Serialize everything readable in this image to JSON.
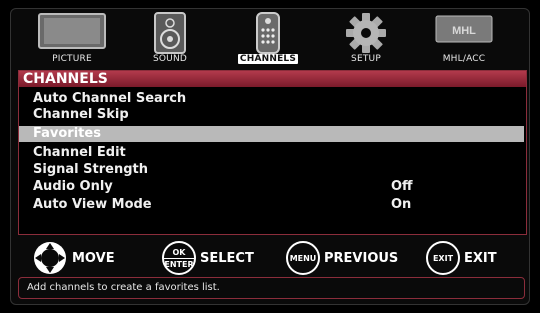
{
  "tabs": [
    {
      "label": "PICTURE",
      "icon": "tv-icon"
    },
    {
      "label": "SOUND",
      "icon": "speaker-icon"
    },
    {
      "label": "CHANNELS",
      "icon": "remote-icon",
      "active": true
    },
    {
      "label": "SETUP",
      "icon": "gear-icon"
    },
    {
      "label": "MHL/ACC",
      "icon": "mhl-logo-icon",
      "logo_text": "MHL"
    }
  ],
  "panel": {
    "title": "CHANNELS",
    "items": [
      {
        "label": "Auto Channel Search",
        "value": ""
      },
      {
        "label": "Channel Skip",
        "value": ""
      },
      {
        "label": "Favorites",
        "value": "",
        "selected": true
      },
      {
        "label": "Channel Edit",
        "value": ""
      },
      {
        "label": "Signal Strength",
        "value": ""
      },
      {
        "label": "Audio Only",
        "value": "Off"
      },
      {
        "label": "Auto View Mode",
        "value": "On"
      }
    ]
  },
  "controls": {
    "move": {
      "label": "MOVE",
      "icon": "dpad-icon"
    },
    "select": {
      "label": "SELECT",
      "button_top": "OK",
      "button_bottom": "ENTER"
    },
    "previous": {
      "label": "PREVIOUS",
      "button": "MENU"
    },
    "exit": {
      "label": "EXIT",
      "button": "EXIT"
    }
  },
  "help_text": "Add channels to create a favorites list.",
  "colors": {
    "accent": "#b23a4c",
    "border": "#8b2d3b",
    "selected_row": "#b9b9b9"
  }
}
